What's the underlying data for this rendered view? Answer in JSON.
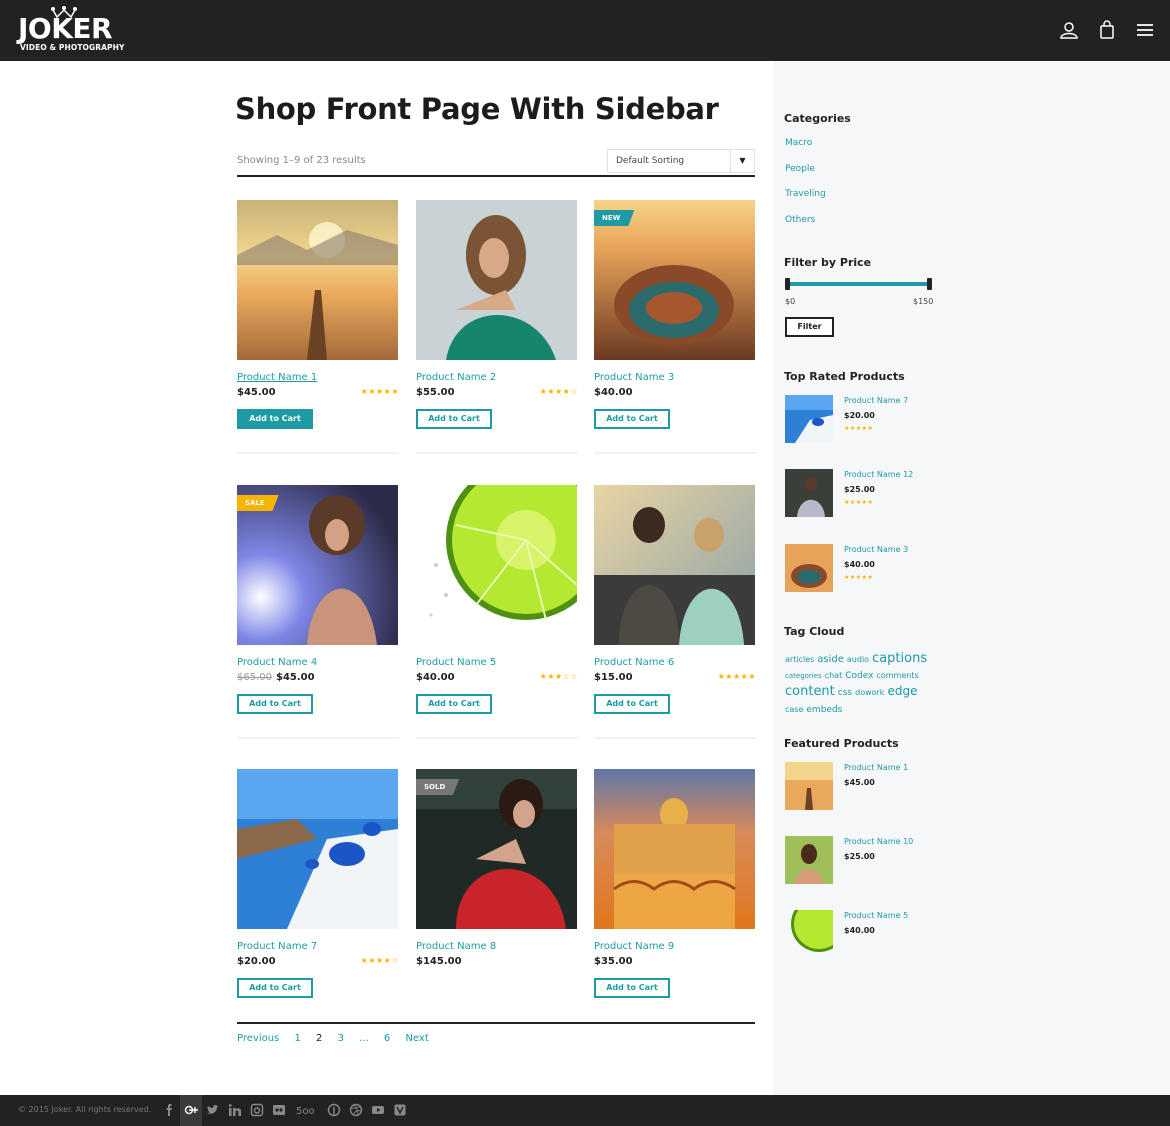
{
  "brand": {
    "name": "JOKER",
    "tagline": "VIDEO & PHOTOGRAPHY"
  },
  "header_icons": [
    "user-icon",
    "shopping-bag-icon",
    "menu-icon"
  ],
  "page": {
    "title": "Shop Front Page With Sidebar",
    "results": "Showing 1–9 of 23 results",
    "sort": {
      "value": "Default Sorting",
      "arrow": "▼"
    }
  },
  "products": [
    {
      "name": "Product Name 1",
      "price": "$45.00",
      "old_price": "",
      "stars": "★★★★★",
      "badge": "",
      "button": "Add to Cart"
    },
    {
      "name": "Product Name 2",
      "price": "$55.00",
      "old_price": "",
      "stars": "★★★★☆",
      "badge": "",
      "button": "Add to Cart"
    },
    {
      "name": "Product Name 3",
      "price": "$40.00",
      "old_price": "",
      "stars": "",
      "badge": "NEW",
      "button": "Add to Cart"
    },
    {
      "name": "Product Name 4",
      "price": "$45.00",
      "old_price": "$65.00",
      "stars": "",
      "badge": "SALE",
      "button": "Add to Cart"
    },
    {
      "name": "Product Name 5",
      "price": "$40.00",
      "old_price": "",
      "stars": "★★★☆☆",
      "badge": "",
      "button": "Add to Cart"
    },
    {
      "name": "Product Name 6",
      "price": "$15.00",
      "old_price": "",
      "stars": "★★★★★",
      "badge": "",
      "button": "Add to Cart"
    },
    {
      "name": "Product Name 7",
      "price": "$20.00",
      "old_price": "",
      "stars": "★★★★☆",
      "badge": "",
      "button": "Add to Cart"
    },
    {
      "name": "Product Name 8",
      "price": "$145.00",
      "old_price": "",
      "stars": "",
      "badge": "SOLD",
      "button": ""
    },
    {
      "name": "Product Name 9",
      "price": "$35.00",
      "old_price": "",
      "stars": "",
      "badge": "",
      "button": "Add to Cart"
    }
  ],
  "pagination": {
    "previous": "Previous",
    "pages": [
      "1",
      "2",
      "3",
      "...",
      "6"
    ],
    "current": "2",
    "next": "Next"
  },
  "sidebar": {
    "categories": {
      "title": "Categories",
      "items": [
        "Macro",
        "People",
        "Traveling",
        "Others"
      ]
    },
    "price_filter": {
      "title": "Filter by Price",
      "min": "$0",
      "max": "$150",
      "button": "Filter"
    },
    "top_rated": {
      "title": "Top Rated Products",
      "items": [
        {
          "name": "Product Name 7",
          "price": "$20.00",
          "stars": "★★★★★"
        },
        {
          "name": "Product Name 12",
          "price": "$25.00",
          "stars": "★★★★★"
        },
        {
          "name": "Product Name 3",
          "price": "$40.00",
          "stars": "★★★★★"
        }
      ]
    },
    "tag_cloud": {
      "title": "Tag Cloud",
      "tags": [
        "articles",
        "aside",
        "audio",
        "captions",
        "categories",
        "chat",
        "Codex",
        "comments",
        "content",
        "css",
        "dowork",
        "edge",
        "case",
        "embeds"
      ]
    },
    "featured": {
      "title": "Featured Products",
      "items": [
        {
          "name": "Product Name 1",
          "price": "$45.00"
        },
        {
          "name": "Product Name 10",
          "price": "$25.00"
        },
        {
          "name": "Product Name 5",
          "price": "$40.00"
        }
      ]
    }
  },
  "footer": {
    "copyright": "© 2015 Joker. All rights reserved.",
    "social_icons": [
      "facebook-icon",
      "google-plus-icon",
      "twitter-icon",
      "linkedin-icon",
      "instagram-icon",
      "flickr-icon",
      "500px-icon",
      "pinterest-icon",
      "dribbble-icon",
      "youtube-icon",
      "vine-icon"
    ]
  },
  "colors": {
    "accent": "#1e9aa5",
    "dark": "#222222",
    "star": "#f5b400",
    "badge_new": "#1e9aa5",
    "badge_sale": "#f5b400",
    "badge_sold": "#777777"
  }
}
